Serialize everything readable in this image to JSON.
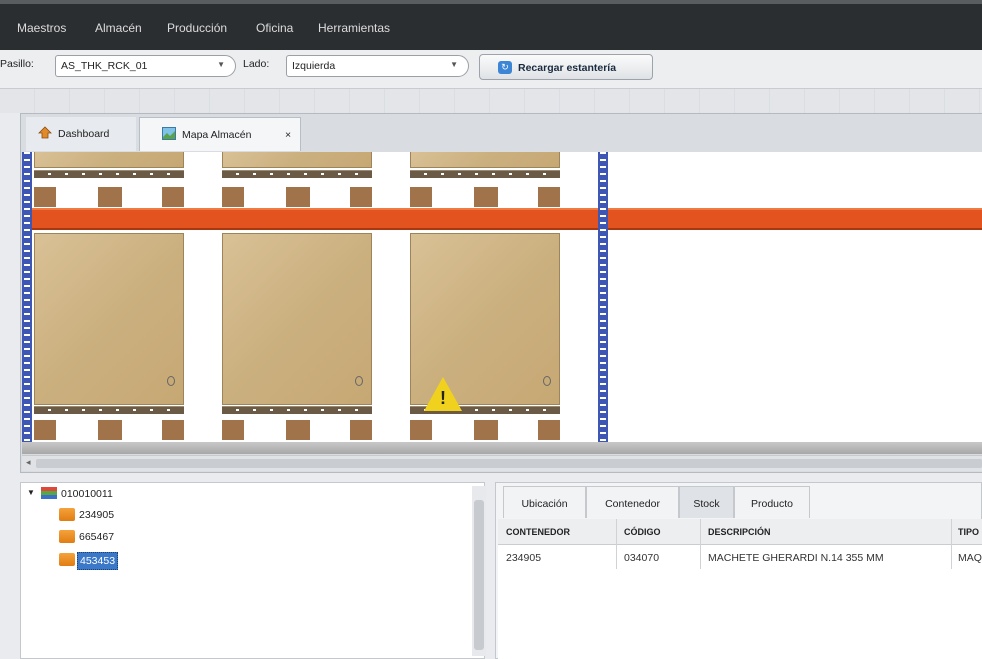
{
  "menu": [
    "Maestros",
    "Almacén",
    "Producción",
    "Oficina",
    "Herramientas"
  ],
  "toolbar": {
    "pasillo_label": "Pasillo:",
    "pasillo_value": "AS_THK_RCK_01",
    "lado_label": "Lado:",
    "lado_value": "Izquierda",
    "reload_label": "Recargar estantería"
  },
  "tabs": [
    {
      "label": "Dashboard"
    },
    {
      "label": "Mapa Almacén",
      "close": "×"
    }
  ],
  "tree": {
    "root": "010010011",
    "children": [
      "234905",
      "665467",
      "453453"
    ]
  },
  "detail_tabs": [
    "Ubicación",
    "Contenedor",
    "Stock",
    "Producto"
  ],
  "stock_table": {
    "headers": [
      "CONTENEDOR",
      "CÓDIGO",
      "DESCRIPCIÓN",
      "TIPO"
    ],
    "rows": [
      [
        "234905",
        "034070",
        "MACHETE GHERARDI N.14 355 MM",
        "MAQ"
      ]
    ]
  },
  "icons": {
    "warning": "warning-icon",
    "home": "dashboard-icon",
    "map": "map-icon"
  },
  "colors": {
    "beam": "#e2531f",
    "upright": "#3f57b4",
    "box": "#cbb07f",
    "warning": "#f0d21e"
  }
}
